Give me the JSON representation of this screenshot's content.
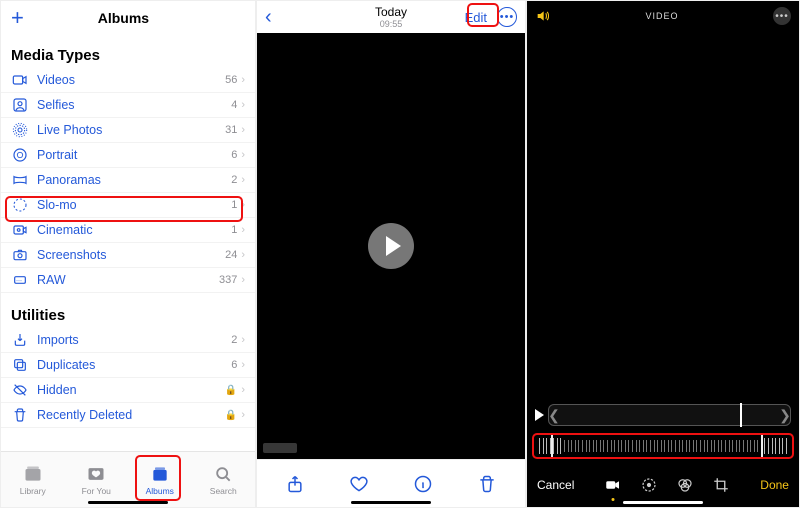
{
  "panel1": {
    "title": "Albums",
    "sections": {
      "media_types_title": "Media Types",
      "utilities_title": "Utilities"
    },
    "media_types": [
      {
        "icon": "video",
        "label": "Videos",
        "count": "56"
      },
      {
        "icon": "selfie",
        "label": "Selfies",
        "count": "4"
      },
      {
        "icon": "livephotos",
        "label": "Live Photos",
        "count": "31"
      },
      {
        "icon": "portrait",
        "label": "Portrait",
        "count": "6"
      },
      {
        "icon": "panorama",
        "label": "Panoramas",
        "count": "2"
      },
      {
        "icon": "slomo",
        "label": "Slo-mo",
        "count": "1"
      },
      {
        "icon": "cinematic",
        "label": "Cinematic",
        "count": "1"
      },
      {
        "icon": "screenshots",
        "label": "Screenshots",
        "count": "24"
      },
      {
        "icon": "raw",
        "label": "RAW",
        "count": "337"
      }
    ],
    "utilities": [
      {
        "icon": "imports",
        "label": "Imports",
        "count": "2",
        "lock": false
      },
      {
        "icon": "duplicates",
        "label": "Duplicates",
        "count": "6",
        "lock": false
      },
      {
        "icon": "hidden",
        "label": "Hidden",
        "count": "",
        "lock": true
      },
      {
        "icon": "recentlydeleted",
        "label": "Recently Deleted",
        "count": "",
        "lock": true
      }
    ],
    "tabs": {
      "library": "Library",
      "foryou": "For You",
      "albums": "Albums",
      "search": "Search"
    }
  },
  "panel2": {
    "title": "Today",
    "subtitle": "09:55",
    "edit_label": "Edit"
  },
  "panel3": {
    "title": "VIDEO",
    "cancel": "Cancel",
    "done": "Done"
  }
}
